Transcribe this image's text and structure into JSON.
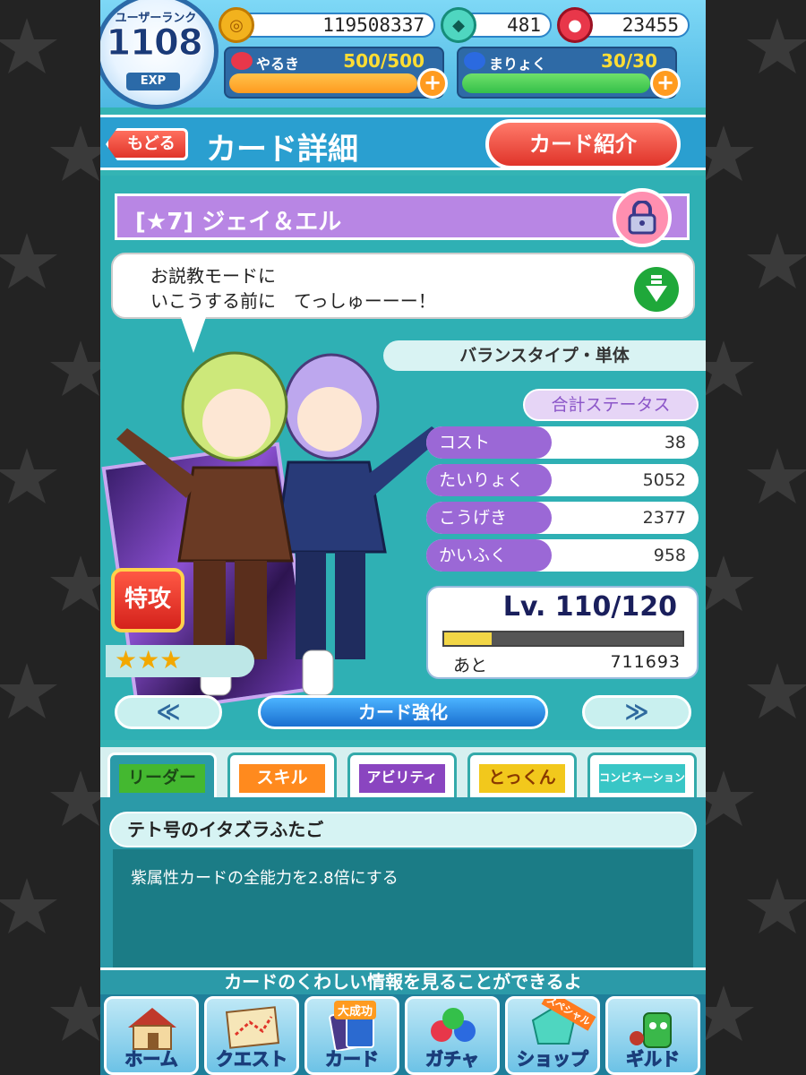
{
  "topbar": {
    "rank_label": "ユーザーランク",
    "rank_value": "1108",
    "exp_label": "EXP",
    "coins": "119508337",
    "gems": "481",
    "meat": "23455",
    "stamina_label": "やるき",
    "stamina_value": "500/500",
    "mana_label": "まりょく",
    "mana_value": "30/30",
    "plus": "+"
  },
  "header": {
    "back_label": "もどる",
    "title": "カード詳細",
    "intro_label": "カード紹介"
  },
  "card": {
    "name": "[★7] ジェイ＆エル",
    "quote_line1": "お説教モードに",
    "quote_line2": "いこうする前に　てっしゅーーー！",
    "type": "バランスタイプ・単体",
    "total_status_label": "合計ステータス",
    "stats": [
      {
        "name": "コスト",
        "value": "38"
      },
      {
        "name": "たいりょく",
        "value": "5052"
      },
      {
        "name": "こうげき",
        "value": "2377"
      },
      {
        "name": "かいふく",
        "value": "958"
      }
    ],
    "level_text": "Lv. 110/120",
    "level_progress": 0.2,
    "next_label": "あと",
    "next_value": "711693",
    "special_label": "特攻",
    "stars": "★★★"
  },
  "nav": {
    "prev": "≪",
    "enhance": "カード強化",
    "next": "≫"
  },
  "tabs": [
    {
      "label": "リーダー",
      "color": "#44b830"
    },
    {
      "label": "スキル",
      "color": "#ff8a1e"
    },
    {
      "label": "アビリティ",
      "color": "#8a45c0"
    },
    {
      "label": "とっくん",
      "color": "#f2c81c"
    },
    {
      "label": "コンビネーション",
      "color": "#39c6c6"
    }
  ],
  "panel": {
    "title": "テト号のイタズラふたご",
    "text": "紫属性カードの全能力を2.8倍にする"
  },
  "footer_message": "カードのくわしい情報を見ることができるよ",
  "bottom_nav": [
    {
      "label": "ホーム",
      "icon": "house-icon"
    },
    {
      "label": "クエスト",
      "icon": "map-icon"
    },
    {
      "label": "カード",
      "icon": "card-icon",
      "badge": "大成功"
    },
    {
      "label": "ガチャ",
      "icon": "puyo-icon"
    },
    {
      "label": "ショップ",
      "icon": "gem-icon",
      "badge": "スペシャル"
    },
    {
      "label": "ギルド",
      "icon": "guild-icon"
    }
  ],
  "colors": {
    "bg_teal": "#34b4b4",
    "accent_red": "#e0352a",
    "purple": "#9b68d6",
    "stamina_bar": "#ff9b1f",
    "mana_bar": "#34c04a"
  }
}
